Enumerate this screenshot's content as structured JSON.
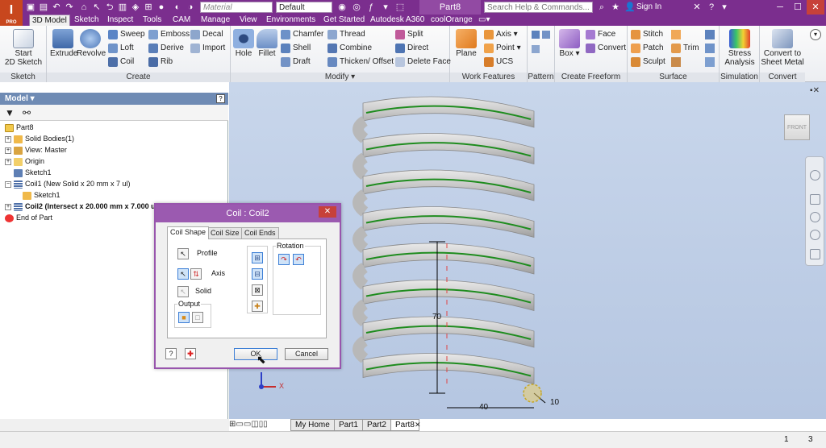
{
  "app": {
    "badge": "I",
    "badge_sub": "PRO",
    "doc_title": "Part8"
  },
  "qat": {
    "material": "Material",
    "appearance": "Default",
    "search_placeholder": "Search Help & Commands...",
    "sign_in": "Sign In"
  },
  "ribbon_tabs": [
    "3D Model",
    "Sketch",
    "Inspect",
    "Tools",
    "CAM",
    "Manage",
    "View",
    "Environments",
    "Get Started",
    "Autodesk A360",
    "coolOrange"
  ],
  "panels": {
    "sketch": {
      "label": "Sketch",
      "start": "Start",
      "start2": "2D Sketch"
    },
    "create": {
      "label": "Create",
      "extrude": "Extrude",
      "revolve": "Revolve",
      "sweep": "Sweep",
      "loft": "Loft",
      "coil": "Coil",
      "emboss": "Emboss",
      "derive": "Derive",
      "rib": "Rib",
      "decal": "Decal",
      "import": "Import"
    },
    "modify": {
      "label": "Modify ▾",
      "hole": "Hole",
      "fillet": "Fillet",
      "chamfer": "Chamfer",
      "shell": "Shell",
      "draft": "Draft",
      "thread": "Thread",
      "combine": "Combine",
      "thicken": "Thicken/ Offset",
      "split": "Split",
      "direct": "Direct",
      "delete_face": "Delete Face"
    },
    "work": {
      "label": "Work Features",
      "plane": "Plane",
      "axis": "Axis",
      "point": "Point",
      "ucs": "UCS"
    },
    "pattern": {
      "label": "Pattern"
    },
    "freeform": {
      "label": "Create Freeform",
      "box": "Box",
      "face": "Face",
      "convert": "Convert"
    },
    "surface": {
      "label": "Surface",
      "stitch": "Stitch",
      "patch": "Patch",
      "sculpt": "Sculpt",
      "trim": "Trim"
    },
    "simulation": {
      "label": "Simulation",
      "stress": "Stress",
      "analysis": "Analysis"
    },
    "convert": {
      "label": "Convert",
      "convert_to": "Convert to",
      "sheet_metal": "Sheet Metal"
    }
  },
  "browser": {
    "title": "Model ▾",
    "help": "?",
    "tree": [
      {
        "label": "Part8",
        "bold": false
      },
      {
        "label": "Solid Bodies(1)",
        "bold": false
      },
      {
        "label": "View: Master",
        "bold": false
      },
      {
        "label": "Origin",
        "bold": false
      },
      {
        "label": "Sketch1",
        "bold": false
      },
      {
        "label": "Coil1 (New Solid x 20 mm x 7 ul)",
        "bold": false
      },
      {
        "label": "Sketch1",
        "bold": false
      },
      {
        "label": "Coil2 (Intersect x 20.000 mm x 7.000 ul)",
        "bold": true
      },
      {
        "label": "End of Part",
        "bold": false
      }
    ]
  },
  "viewport": {
    "viewcube": "FRONT",
    "dim_height": "70",
    "dim_width": "40",
    "dim_radius": "10"
  },
  "dialog": {
    "title": "Coil : Coil2",
    "tabs": [
      "Coil Shape",
      "Coil Size",
      "Coil Ends"
    ],
    "profile": "Profile",
    "axis": "Axis",
    "solid": "Solid",
    "output": "Output",
    "rotation": "Rotation",
    "help": "?",
    "ok": "OK",
    "cancel": "Cancel"
  },
  "doc_tabs": [
    "My Home",
    "Part1",
    "Part2",
    "Part8"
  ],
  "status": {
    "count1": "1",
    "count2": "3"
  },
  "colors": {
    "title_purple": "#7b2e8e",
    "helix_green": "#1e8c1e",
    "viewport_blue": "#bccbe4"
  }
}
